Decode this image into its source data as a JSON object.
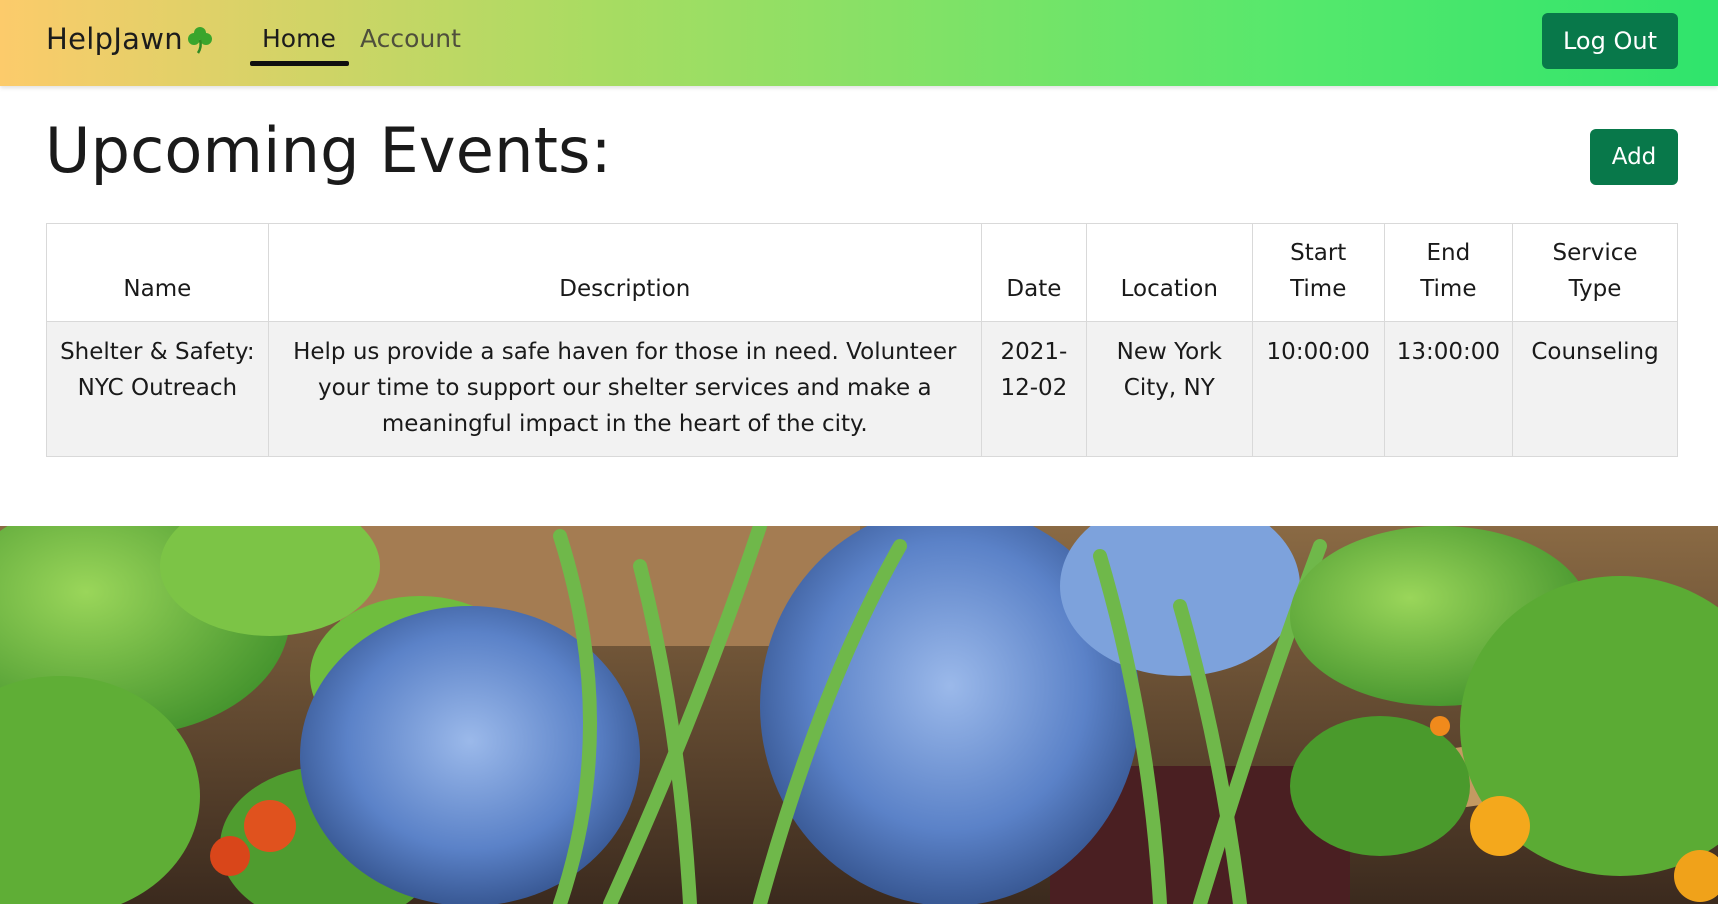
{
  "nav": {
    "brand": "HelpJawn",
    "brand_icon": "shamrock-icon",
    "links": [
      {
        "label": "Home",
        "active": true
      },
      {
        "label": "Account",
        "active": false
      }
    ],
    "logout_label": "Log Out"
  },
  "main": {
    "title": "Upcoming Events:",
    "add_label": "Add",
    "table": {
      "headers": [
        "Name",
        "Description",
        "Date",
        "Location",
        "Start Time",
        "End Time",
        "Service Type"
      ],
      "rows": [
        {
          "name": "Shelter & Safety: NYC Outreach",
          "description": "Help us provide a safe haven for those in need. Volunteer your time to support our shelter services and make a meaningful impact in the heart of the city.",
          "date": "2021-12-02",
          "location": "New York City, NY",
          "start_time": "10:00:00",
          "end_time": "13:00:00",
          "service_type": "Counseling"
        }
      ]
    }
  },
  "colors": {
    "nav_gradient_start": "#fccb6b",
    "nav_gradient_end": "#2fe46c",
    "button_green": "#08784a"
  }
}
